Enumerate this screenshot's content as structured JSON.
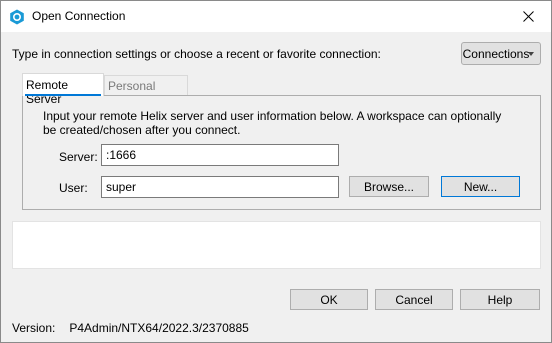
{
  "window": {
    "title": "Open Connection"
  },
  "instruction": "Type in connection settings or choose a recent or favorite connection:",
  "connections_button": "Connections",
  "tabs": [
    {
      "label": "Remote Server",
      "selected": true
    },
    {
      "label": "Personal Server",
      "selected": false
    }
  ],
  "remote": {
    "description": "Input your remote Helix server and user information below. A workspace can optionally be created/chosen after you connect.",
    "server_label": "Server:",
    "server_value": ":1666",
    "user_label": "User:",
    "user_value": "super",
    "browse_label": "Browse...",
    "new_label": "New..."
  },
  "footer": {
    "ok_label": "OK",
    "cancel_label": "Cancel",
    "help_label": "Help",
    "version_label": "Version:",
    "version_value": "P4Admin/NTX64/2022.3/2370885"
  },
  "colors": {
    "accent": "#0078d7",
    "app_icon": "#1a9ad6"
  },
  "icons": {
    "app": "p4admin-hex-icon",
    "close": "close-icon",
    "dropdown": "chevron-down-icon"
  }
}
